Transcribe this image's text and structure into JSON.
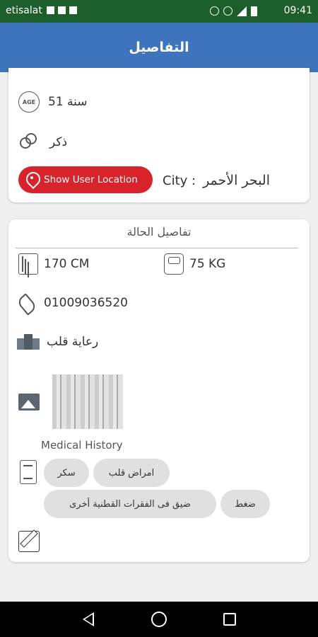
{
  "status_bar": {
    "carrier": "etisalat",
    "time": "09:41"
  },
  "app_bar": {
    "title": "التفاصيل"
  },
  "profile": {
    "age_value": "51 سنة",
    "gender_value": "ذكر",
    "location_button": "Show User Location",
    "city_label": "City :",
    "city_value": "البحر الأحمر"
  },
  "details": {
    "section_title": "تفاصيل الحالة",
    "height": "170 CM",
    "weight": "75 KG",
    "phone": "01009036520",
    "specialty": "رعاية قلب",
    "medical_history_label": "Medical History",
    "conditions": [
      "امراض قلب",
      "سكر",
      "ضغط",
      "ضيق فى الفقرات القطنية  أخرى"
    ]
  }
}
